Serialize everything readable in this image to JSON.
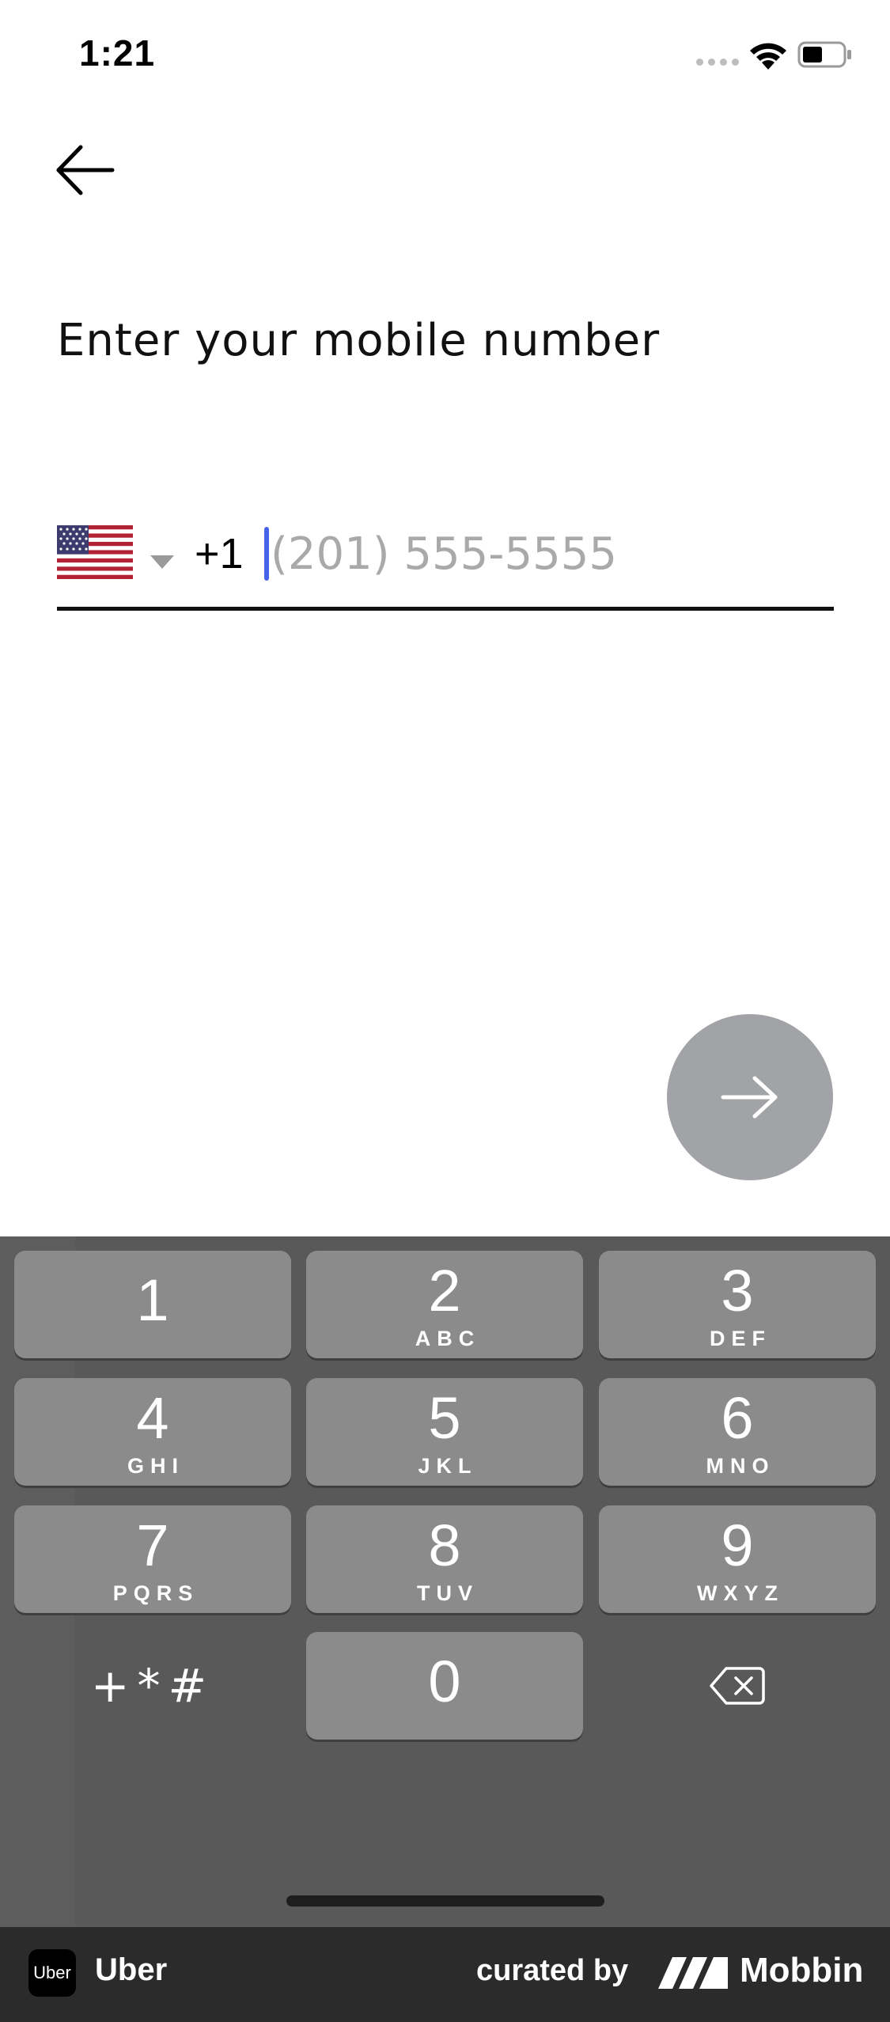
{
  "status_bar": {
    "time": "1:21",
    "icons": [
      "signal-dots-icon",
      "wifi-icon",
      "battery-icon"
    ]
  },
  "navigation": {
    "back_icon": "arrow-left-icon"
  },
  "page": {
    "title": "Enter your mobile number"
  },
  "phone_input": {
    "country_flag": "us-flag-icon",
    "dial_code": "+1",
    "value": "",
    "placeholder": "(201) 555-5555"
  },
  "next_button": {
    "icon": "arrow-right-icon",
    "color": "#a2a3a7"
  },
  "keypad": {
    "keys": [
      {
        "digit": "1",
        "letters": ""
      },
      {
        "digit": "2",
        "letters": "ABC"
      },
      {
        "digit": "3",
        "letters": "DEF"
      },
      {
        "digit": "4",
        "letters": "GHI"
      },
      {
        "digit": "5",
        "letters": "JKL"
      },
      {
        "digit": "6",
        "letters": "MNO"
      },
      {
        "digit": "7",
        "letters": "PQRS"
      },
      {
        "digit": "8",
        "letters": "TUV"
      },
      {
        "digit": "9",
        "letters": "WXYZ"
      },
      {
        "digit": "0",
        "letters": ""
      }
    ],
    "symbols_label": "+*#",
    "delete_icon": "backspace-icon"
  },
  "footer": {
    "app_logo_text": "Uber",
    "app_name": "Uber",
    "curated_label": "curated by",
    "brand_name": "Mobbin"
  },
  "colors": {
    "cursor": "#4563e8",
    "keypad_bg": "#595959",
    "key_bg": "#8b8b8b",
    "footer_bg": "#2b2b2b"
  }
}
